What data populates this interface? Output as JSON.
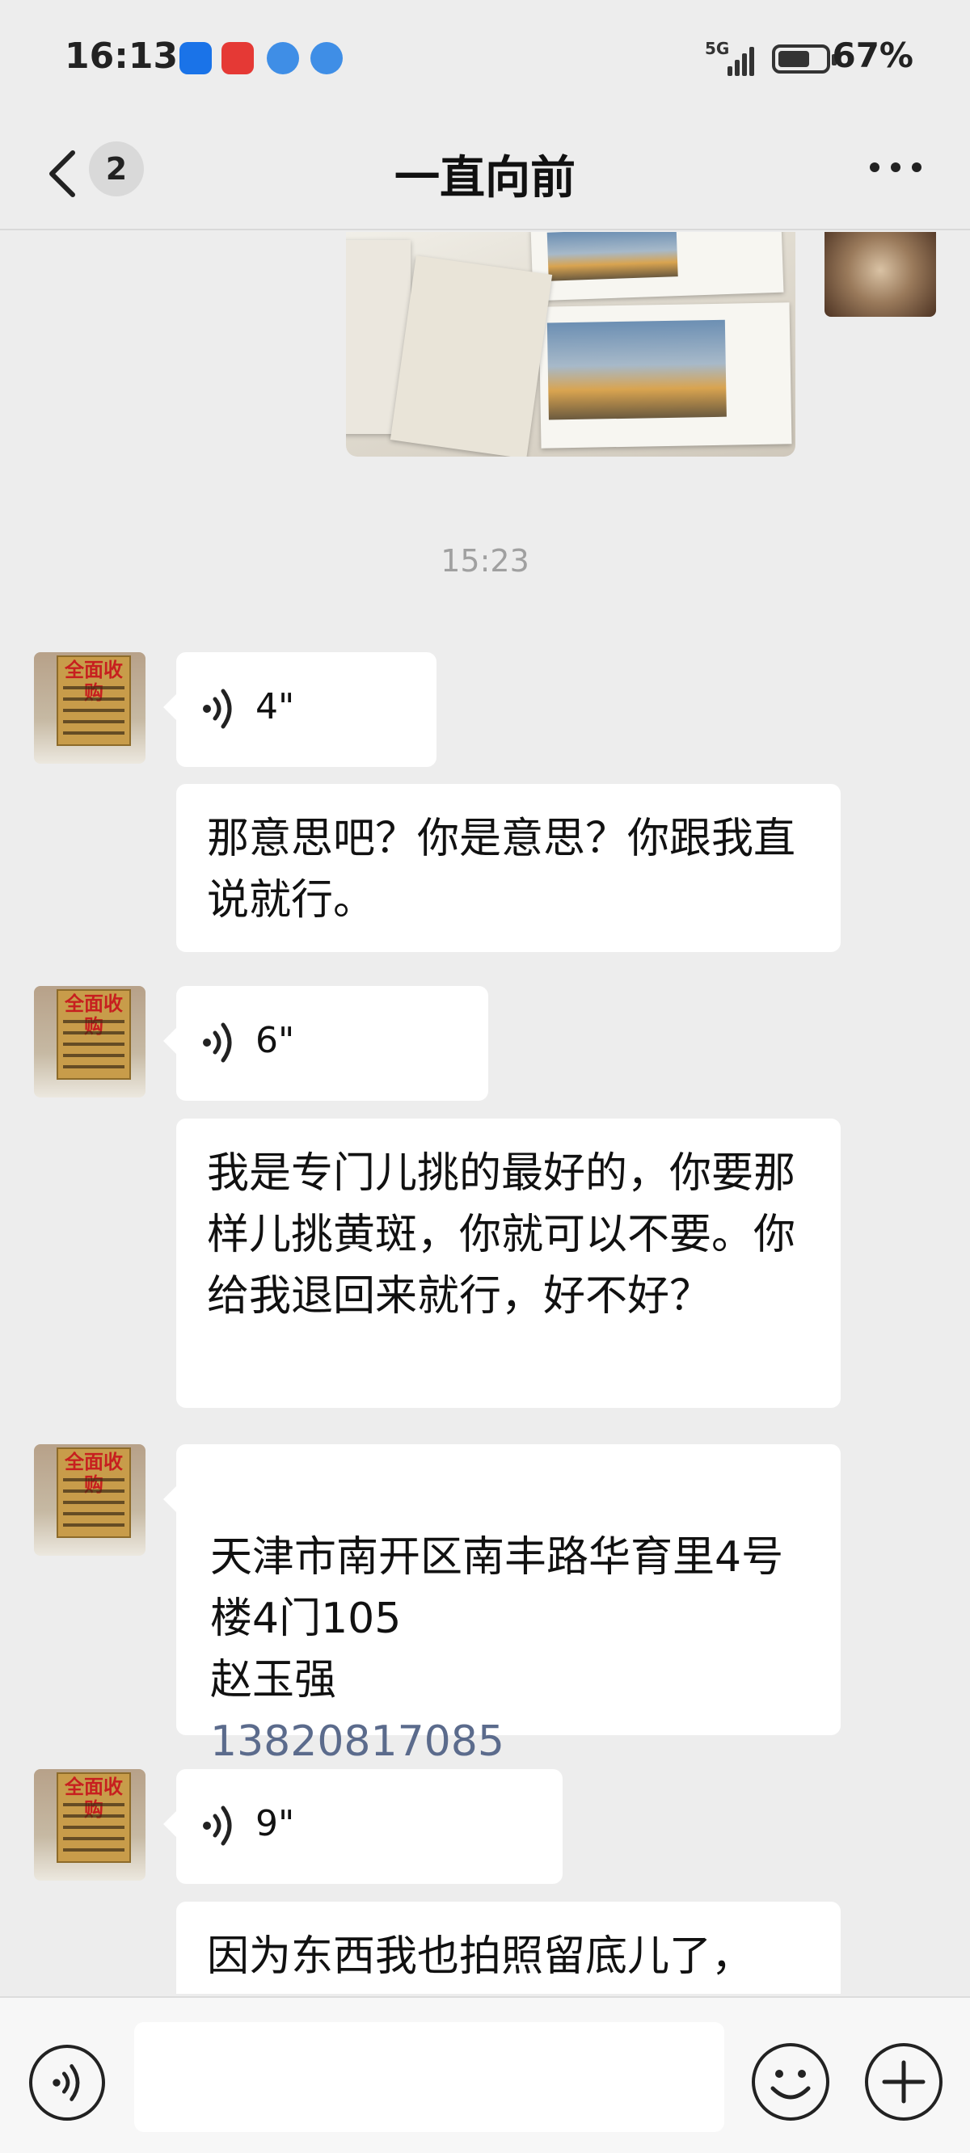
{
  "status_bar": {
    "time": "16:13",
    "network": "5G",
    "battery_percent": "67%",
    "battery_level": 0.67,
    "app_icons": [
      "browser-icon",
      "stock-app-icon",
      "planet-app-icon",
      "planet-app-icon"
    ]
  },
  "header": {
    "back_icon": "chevron-left-icon",
    "unread_count": "2",
    "title": "一直向前",
    "more_icon": "more-dots-icon"
  },
  "chat": {
    "timestamp": "15:23",
    "messages": [
      {
        "type": "voice",
        "duration": "4\""
      },
      {
        "type": "text",
        "text": "那意思吧？你是意思？你跟我直说就行。"
      },
      {
        "type": "voice",
        "duration": "6\""
      },
      {
        "type": "text",
        "text": "我是专门儿挑的最好的，你要那样儿挑黄斑，你就可以不要。你给我退回来就行，好不好？"
      },
      {
        "type": "text_with_phone",
        "text": "天津市南开区南丰路华育里4号楼4门105\n赵玉强",
        "phone": "13820817085"
      },
      {
        "type": "voice",
        "duration": "9\""
      },
      {
        "type": "text",
        "text": "因为东西我也拍照留底儿了，"
      }
    ],
    "avatar_sign_text": "全面收购"
  },
  "input_bar": {
    "voice_icon": "voice-input-icon",
    "placeholder": "",
    "emoji_icon": "emoji-icon",
    "plus_icon": "plus-icon"
  }
}
